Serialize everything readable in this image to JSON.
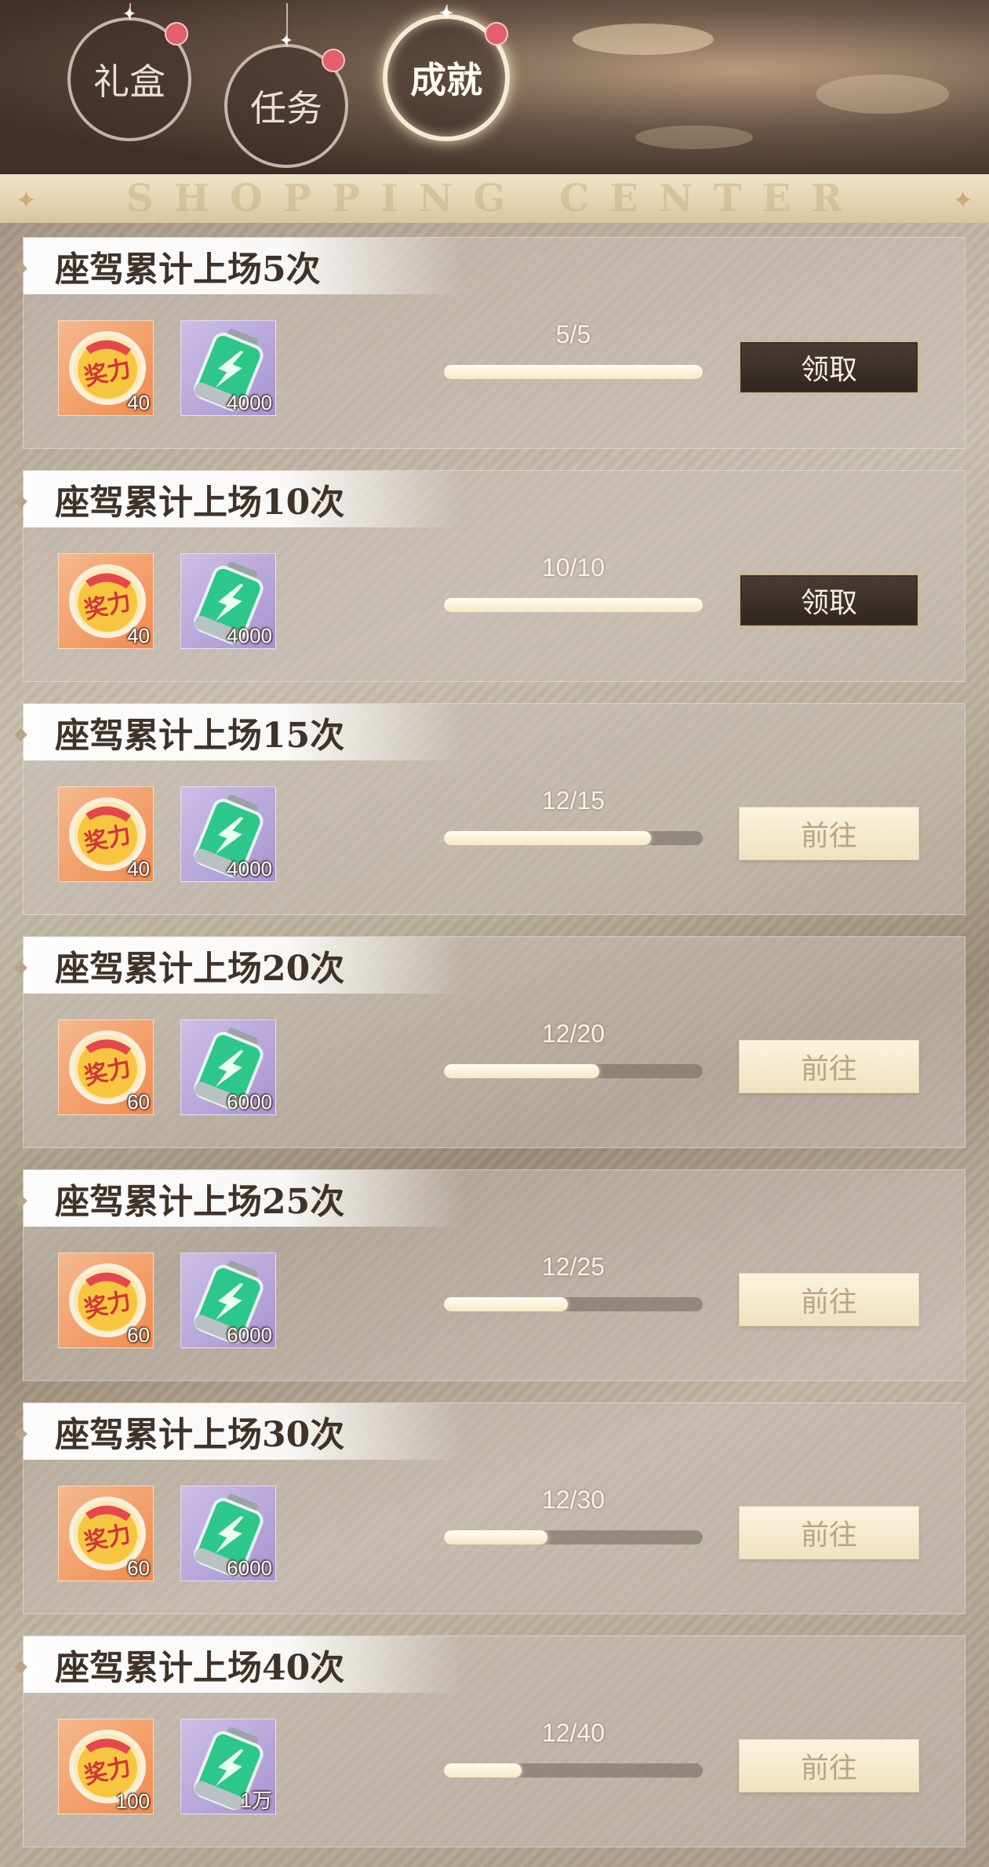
{
  "tabs": [
    {
      "label": "礼盒",
      "active": false,
      "has_badge": true
    },
    {
      "label": "任务",
      "active": false,
      "has_badge": true
    },
    {
      "label": "成就",
      "active": true,
      "has_badge": true
    }
  ],
  "banner": {
    "text": "SHOPPING CENTER"
  },
  "colors": {
    "badge": "#e2606a",
    "claim_button": "#2f2520",
    "go_button": "#f3e8cc",
    "progress_fill": "#fbf5e0"
  },
  "icons": {
    "reward_1": "medal-icon",
    "reward_2": "battery-icon",
    "badge": "notification-dot-icon"
  },
  "achievements": [
    {
      "title": "座驾累计上场5次",
      "reward_medal_qty": "40",
      "reward_battery_qty": "4000",
      "progress": "5/5",
      "progress_fraction": 1.0,
      "button": "领取",
      "button_type": "claim"
    },
    {
      "title": "座驾累计上场10次",
      "reward_medal_qty": "40",
      "reward_battery_qty": "4000",
      "progress": "10/10",
      "progress_fraction": 1.0,
      "button": "领取",
      "button_type": "claim"
    },
    {
      "title": "座驾累计上场15次",
      "reward_medal_qty": "40",
      "reward_battery_qty": "4000",
      "progress": "12/15",
      "progress_fraction": 0.8,
      "button": "前往",
      "button_type": "go"
    },
    {
      "title": "座驾累计上场20次",
      "reward_medal_qty": "60",
      "reward_battery_qty": "6000",
      "progress": "12/20",
      "progress_fraction": 0.6,
      "button": "前往",
      "button_type": "go"
    },
    {
      "title": "座驾累计上场25次",
      "reward_medal_qty": "60",
      "reward_battery_qty": "6000",
      "progress": "12/25",
      "progress_fraction": 0.48,
      "button": "前往",
      "button_type": "go"
    },
    {
      "title": "座驾累计上场30次",
      "reward_medal_qty": "60",
      "reward_battery_qty": "6000",
      "progress": "12/30",
      "progress_fraction": 0.4,
      "button": "前往",
      "button_type": "go"
    },
    {
      "title": "座驾累计上场40次",
      "reward_medal_qty": "100",
      "reward_battery_qty": "1万",
      "progress": "12/40",
      "progress_fraction": 0.3,
      "button": "前往",
      "button_type": "go"
    }
  ],
  "medal_text": "奖力"
}
